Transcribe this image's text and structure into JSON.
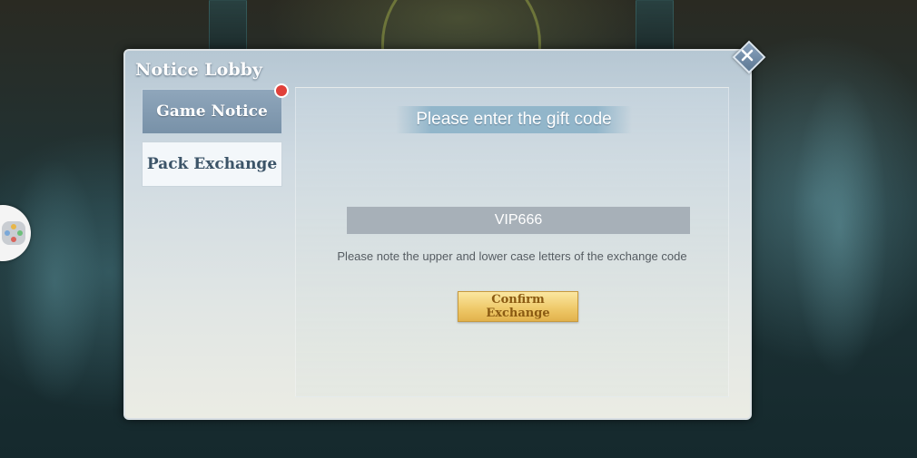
{
  "dialog": {
    "title": "Notice Lobby"
  },
  "tabs": [
    {
      "label": "Game Notice",
      "has_notification": true
    },
    {
      "label": "Pack Exchange",
      "selected": true
    }
  ],
  "gift": {
    "header": "Please enter the gift code",
    "code_value": "VIP666",
    "note": "Please note the upper and lower case letters of the exchange code",
    "confirm_label": "Confirm Exchange"
  },
  "colors": {
    "notification_dot": "#e0403a",
    "confirm_button": "#efca6b",
    "input_bg": "#a7b0b8"
  },
  "icons": {
    "close": "close-icon",
    "side_float": "gamepad-icon"
  }
}
